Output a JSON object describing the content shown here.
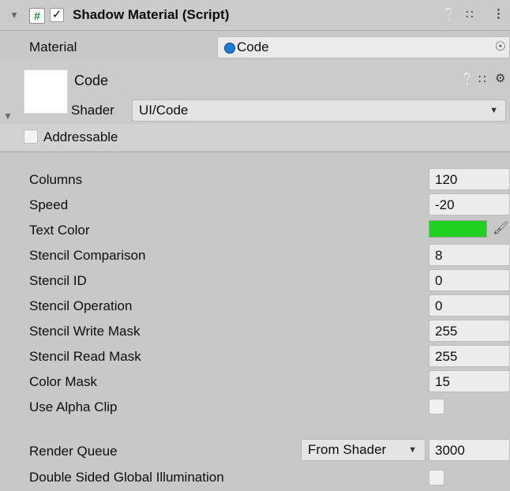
{
  "header": {
    "title": "Shadow Material (Script)",
    "enabled_check": "✓",
    "script_glyph": "#",
    "icons": [
      "help-icon",
      "preset-icon",
      "kebab-menu-icon"
    ]
  },
  "material_row": {
    "label": "Material",
    "value": "Code"
  },
  "material_box": {
    "name": "Code",
    "shader_label": "Shader",
    "shader_value": "UI/Code",
    "addressable_label": "Addressable"
  },
  "properties": [
    {
      "label": "Columns",
      "value": "120"
    },
    {
      "label": "Speed",
      "value": "-20"
    },
    {
      "label": "Text Color",
      "color": "#1fd21f"
    },
    {
      "label": "Stencil Comparison",
      "value": "8"
    },
    {
      "label": "Stencil ID",
      "value": "0"
    },
    {
      "label": "Stencil Operation",
      "value": "0"
    },
    {
      "label": "Stencil Write Mask",
      "value": "255"
    },
    {
      "label": "Stencil Read Mask",
      "value": "255"
    },
    {
      "label": "Color Mask",
      "value": "15"
    },
    {
      "label": "Use Alpha Clip",
      "checked": false
    }
  ],
  "render_queue": {
    "label": "Render Queue",
    "mode": "From Shader",
    "value": "3000"
  },
  "double_sided": {
    "label": "Double Sided Global Illumination",
    "checked": false
  }
}
